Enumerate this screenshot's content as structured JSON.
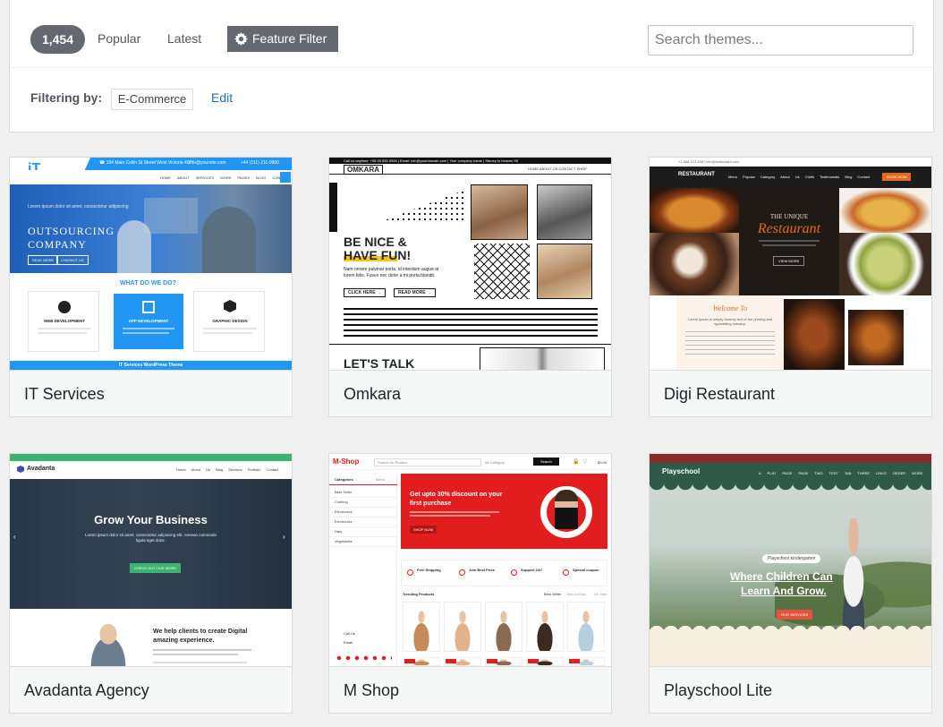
{
  "toolbar": {
    "count": "1,454",
    "popular_label": "Popular",
    "latest_label": "Latest",
    "feature_filter_label": "Feature Filter",
    "search_placeholder": "Search themes..."
  },
  "filter": {
    "label": "Filtering by:",
    "tag": "E-Commerce",
    "edit_label": "Edit"
  },
  "themes": [
    {
      "name": "IT Services",
      "preview": {
        "topbar": "☎ 184 Main Collin St Street West Victoria 407",
        "email": "info@yoursite.com",
        "phone": "+44 (111) 211-9900",
        "nav": [
          "HOME",
          "ABOUT",
          "SERVICES",
          "WORK",
          "PAGES",
          "BLOG",
          "CONTACT"
        ],
        "hero_small": "Lorem ipsum dolor sit amet, consectetur adipiscing",
        "hero_title_1": "OUTSOURCING",
        "hero_title_2": "COMPANY",
        "btn_1": "READ MORE",
        "btn_2": "CONTACT US",
        "section_title": "WHAT DO WE DO?",
        "boxes": [
          "WEB DEVELOPMENT",
          "APP DEVELOPMENT",
          "GRAPHIC DESIGN"
        ],
        "footer": "IT Services WordPress Theme"
      }
    },
    {
      "name": "Omkara",
      "preview": {
        "topbar": "Call us anytime: +55 55 555 5555 | Email: info@yourdomain.com | Your company name | Stoney to heaven 55",
        "logo": "OMKARA",
        "nav": "HOME ABOUT US CONTACT SHOP",
        "headline_1": "BE NICE &",
        "headline_2": "HAVE FUN!",
        "body": "Nam ornare pulvinar porta, id interdum augue at lorem felis. Fusce nec dolor a mi porta blandit.",
        "btn_1": "CLICK HERE →",
        "btn_2": "READ MORE →",
        "bottom": "LET'S TALK"
      }
    },
    {
      "name": "Digi Restaurant",
      "preview": {
        "topbar": "+1 888 123 4567   info@restaurant.com",
        "logo": "RESTAURANT",
        "nav": [
          "Menu",
          "Popular",
          "Category",
          "About Us",
          "Chefs",
          "Testimonials",
          "Blog",
          "Contact"
        ],
        "cta": "BOOK NOW",
        "hero_small": "THE UNIQUE",
        "hero_title": "Restaurant",
        "hero_btn": "VIEW MORE",
        "welcome": "Welcome To",
        "welcome_text": "Lorem ipsum is simply dummy text of the printing and typesetting industry."
      }
    },
    {
      "name": "Avadanta Agency",
      "preview": {
        "logo": "Avadanta",
        "nav": [
          "Home",
          "About Us",
          "Blog",
          "Services",
          "Portfolio",
          "Contact"
        ],
        "hero_title": "Grow Your Business",
        "hero_text": "Lorem ipsum dolor sit amet, consectetur adipiscing elit. Aenean commodo ligula eget dolor.",
        "hero_btn": "CHECK OUT OUR WORK",
        "section_title_1": "We help clients to create Digital",
        "section_title_2": "amazing experience."
      }
    },
    {
      "name": "M Shop",
      "preview": {
        "logo": "M-Shop",
        "search_placeholder": "Search for Product",
        "category_select": "All Category",
        "search_btn": "Search",
        "cart": "$0.00",
        "sidebar_title": "Categories",
        "sidebar_tab": "Menu",
        "categories": [
          "Best Seller",
          "Clothing",
          "Electronics",
          "Electronics",
          "Hats",
          "Vegetables"
        ],
        "banner_title_1": "Get upto 30% discount on your",
        "banner_title_2": "first purchase",
        "banner_btn": "SHOP NOW",
        "features": [
          "Free Shipping",
          "Join Best Price",
          "Support 24/7",
          "Special coupon"
        ],
        "trending": "Trending Products",
        "tabs": [
          "Best Seller",
          "New Arrivals",
          "On Sale"
        ],
        "call": "Call Us",
        "email": "Email"
      }
    },
    {
      "name": "Playschool Lite",
      "preview": {
        "logo": "Playschool",
        "nav": [
          "A PLAY PAGE",
          "PAGE TWO",
          "TEST TAB THREE",
          "LINKS",
          "ORDER",
          "MORE"
        ],
        "tag": "Playschool kindergarten",
        "hero_1": "Where Children Can",
        "hero_2": "Learn And Grow.",
        "hero_btn": "OUR SERVICES"
      }
    }
  ],
  "colors": {
    "accent": "#2271b1",
    "badge": "#646970",
    "it_blue": "#2196f3",
    "mshop_red": "#e21d1d",
    "avadanta_green": "#3cb371",
    "restaurant_orange": "#e56a1b"
  }
}
